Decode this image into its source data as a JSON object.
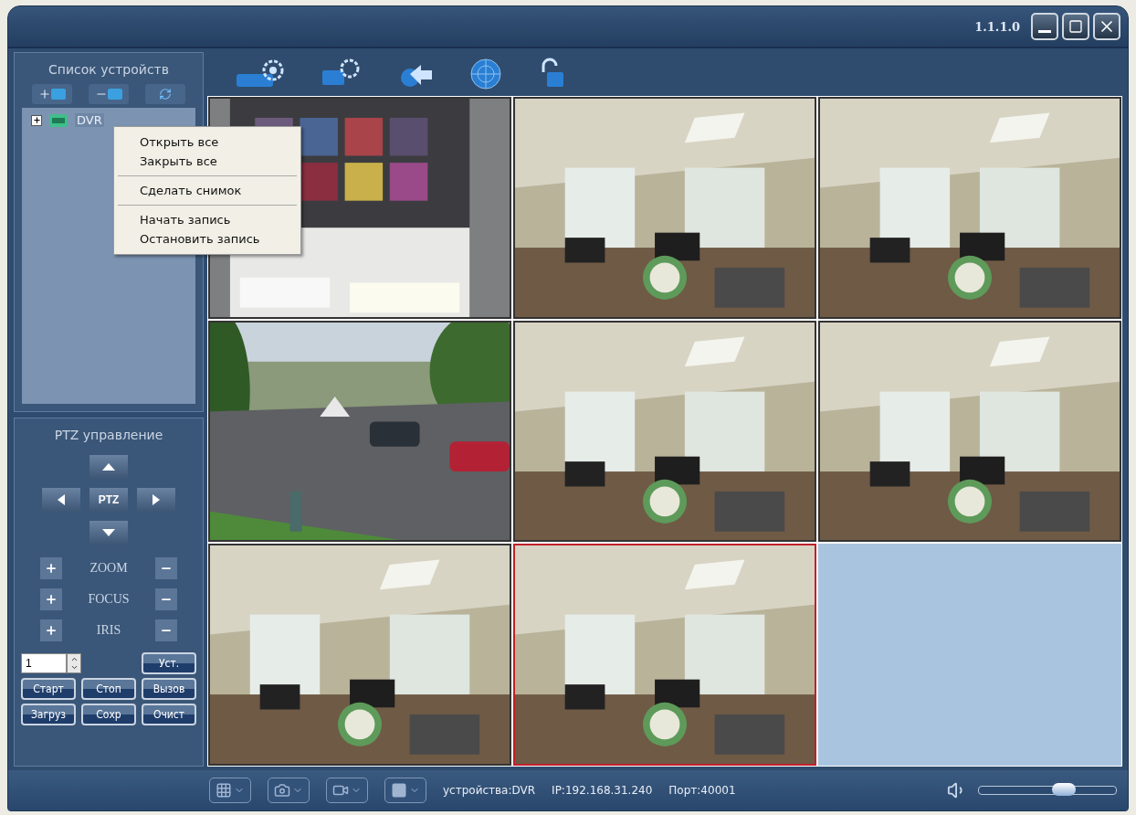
{
  "window": {
    "version": "1.1.1.0"
  },
  "device_list": {
    "title": "Список устройств",
    "tree": [
      {
        "label": "DVR",
        "expanded": false
      }
    ]
  },
  "context_menu": {
    "groups": [
      [
        "Открыть все",
        "Закрыть все"
      ],
      [
        "Сделать снимок"
      ],
      [
        "Начать запись",
        "Остановить запись"
      ]
    ]
  },
  "ptz": {
    "title": "PTZ управление",
    "center": "PTZ",
    "adjust_rows": [
      "ZOOM",
      "FOCUS",
      "IRIS"
    ],
    "preset": {
      "value": "1"
    },
    "set_button": "Уст.",
    "buttons": [
      "Старт",
      "Стоп",
      "Вызов",
      "Загруз",
      "Сохр",
      "Очист"
    ]
  },
  "video_cells": [
    {
      "kind": "chart",
      "selected": false
    },
    {
      "kind": "office",
      "selected": false
    },
    {
      "kind": "office",
      "selected": false
    },
    {
      "kind": "street",
      "selected": false
    },
    {
      "kind": "office",
      "selected": false
    },
    {
      "kind": "office",
      "selected": false
    },
    {
      "kind": "office",
      "selected": false
    },
    {
      "kind": "office",
      "selected": true
    },
    {
      "kind": "empty",
      "selected": false
    }
  ],
  "status_bar": {
    "device": "устройства:DVR",
    "ip": "IP:192.168.31.240",
    "port": "Порт:40001",
    "volume": {
      "level": 0.62
    }
  }
}
